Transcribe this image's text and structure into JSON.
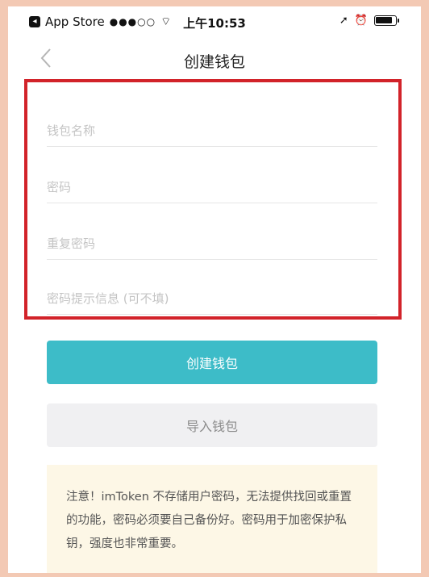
{
  "status_bar": {
    "carrier": "App Store",
    "signal": "●●●○○",
    "time": "上午10:53"
  },
  "nav": {
    "title": "创建钱包"
  },
  "form": {
    "wallet_name_placeholder": "钱包名称",
    "password_placeholder": "密码",
    "repeat_password_placeholder": "重复密码",
    "hint_placeholder": "密码提示信息 (可不填)"
  },
  "buttons": {
    "create_label": "创建钱包",
    "import_label": "导入钱包"
  },
  "notice": {
    "text": "注意！imToken 不存储用户密码，无法提供找回或重置的功能，密码必须要自己备份好。密码用于加密保护私钥，强度也非常重要。"
  },
  "colors": {
    "primary": "#3dbcc8",
    "highlight_border": "#d2232a",
    "notice_bg": "#fdf7e6"
  }
}
